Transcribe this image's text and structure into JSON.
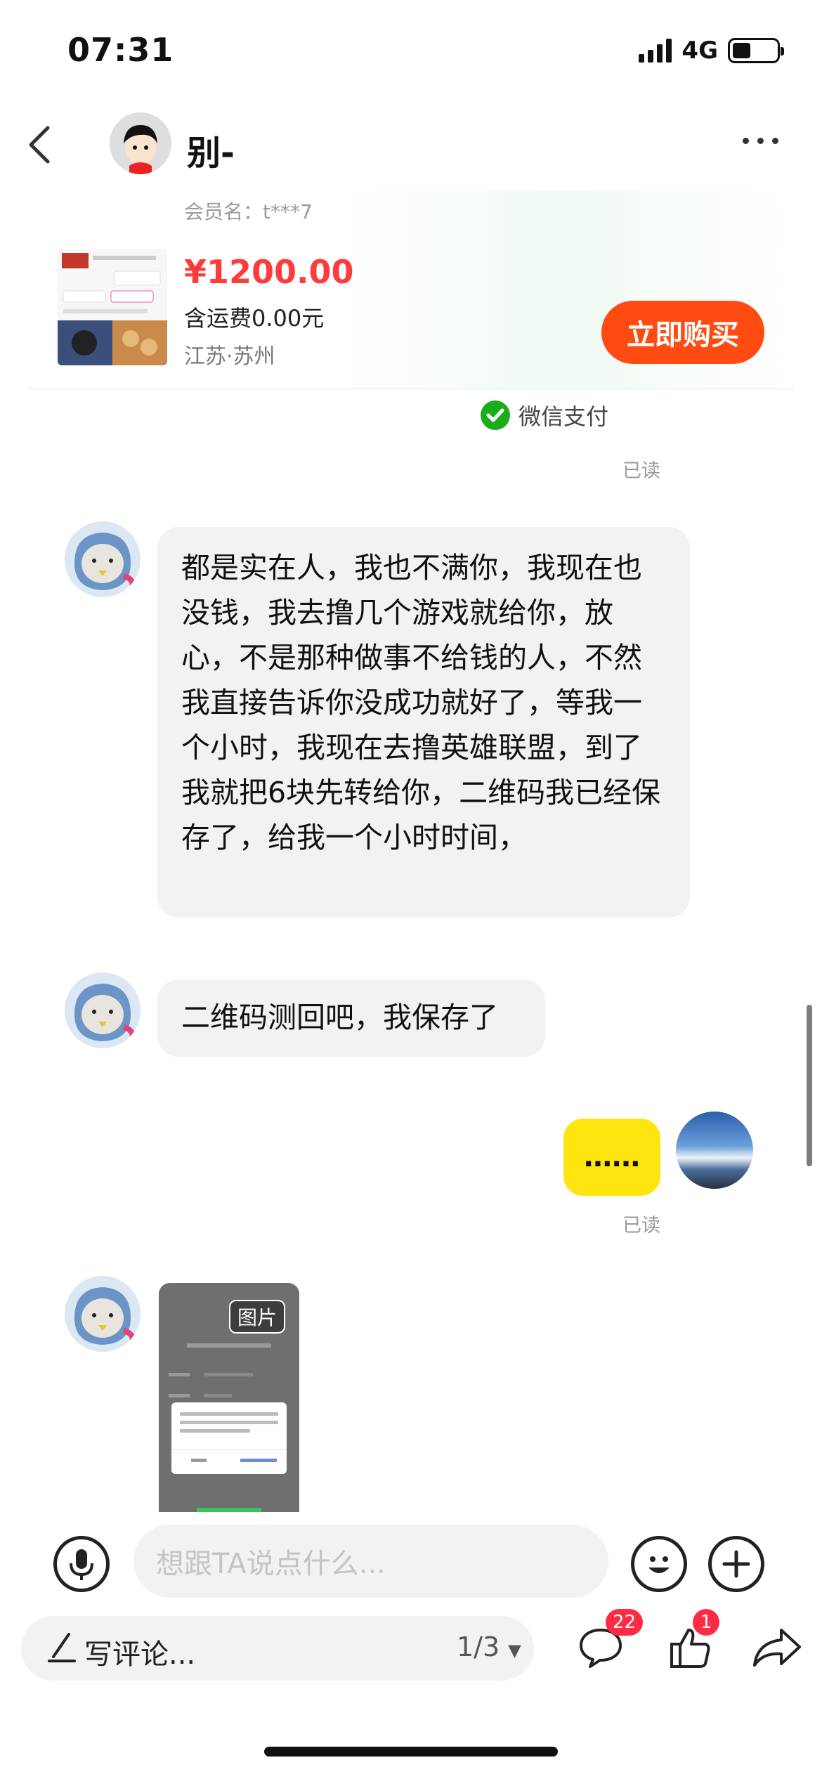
{
  "status_bar": {
    "time": "07:31",
    "network": "4G"
  },
  "header": {
    "contact_name": "别-"
  },
  "product": {
    "member": "会员名：t***7",
    "price": "¥1200.00",
    "shipping": "含运费0.00元",
    "location": "江苏·苏州",
    "buy_label": "立即购买"
  },
  "payment": {
    "label": "微信支付",
    "read": "已读"
  },
  "messages": [
    {
      "from": "them",
      "text": "都是实在人，我也不满你，我现在也没钱，我去撸几个游戏就给你，放心，不是那种做事不给钱的人，不然我直接告诉你没成功就好了，等我一个小时，我现在去撸英雄联盟，到了我就把6块先转给你，二维码我已经保存了，给我一个小时时间，"
    },
    {
      "from": "them",
      "text": "二维码测回吧，我保存了"
    },
    {
      "from": "me",
      "text": "……",
      "read": "已读"
    },
    {
      "from": "them",
      "image_tag": "图片"
    }
  ],
  "input": {
    "placeholder": "想跟TA说点什么..."
  },
  "bottom_bar": {
    "comment_placeholder": "写评论...",
    "page_indicator": "1/3",
    "comment_count": "22",
    "like_count": "1"
  },
  "colors": {
    "accent": "#ff4b12",
    "price": "#ff3b3b",
    "my_bubble": "#ffe50f",
    "badge": "#ff2b45"
  }
}
